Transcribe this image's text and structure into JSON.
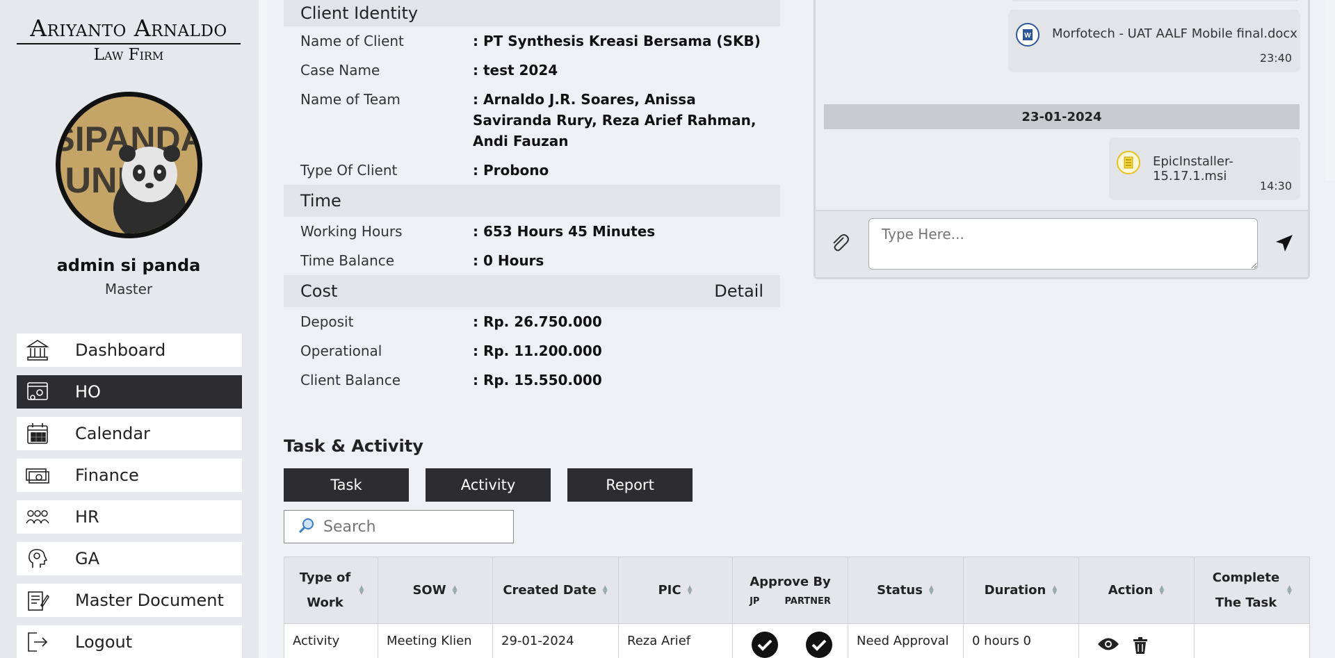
{
  "logo": {
    "line1": "Ariyanto Arnaldo",
    "line2": "Law Firm"
  },
  "avatar": {
    "text": "SIPANDA UNIK"
  },
  "user": {
    "name": "admin si panda",
    "role": "Master"
  },
  "nav": [
    {
      "label": "Dashboard",
      "icon": "bank-icon",
      "active": false
    },
    {
      "label": "HO",
      "icon": "settings-window-icon",
      "active": true
    },
    {
      "label": "Calendar",
      "icon": "calendar-icon",
      "active": false
    },
    {
      "label": "Finance",
      "icon": "money-icon",
      "active": false
    },
    {
      "label": "HR",
      "icon": "people-icon",
      "active": false
    },
    {
      "label": "GA",
      "icon": "head-gear-icon",
      "active": false
    },
    {
      "label": "Master Document",
      "icon": "document-edit-icon",
      "active": false
    },
    {
      "label": "Logout",
      "icon": "logout-icon",
      "active": false
    }
  ],
  "client": {
    "section": "Client Identity",
    "rows": [
      {
        "k": "Name of Client",
        "v": ": PT Synthesis Kreasi Bersama (SKB)"
      },
      {
        "k": "Case Name",
        "v": ": test 2024"
      },
      {
        "k": "Name of Team",
        "v": ": Arnaldo J.R. Soares, Anissa Saviranda Rury, Reza Arief Rahman, Andi Fauzan"
      },
      {
        "k": "Type Of Client",
        "v": ": Probono"
      }
    ]
  },
  "time": {
    "section": "Time",
    "rows": [
      {
        "k": "Working Hours",
        "v": ": 653 Hours 45 Minutes"
      },
      {
        "k": "Time Balance",
        "v": ": 0 Hours"
      }
    ]
  },
  "cost": {
    "section": "Cost",
    "detail": "Detail",
    "rows": [
      {
        "k": "Deposit",
        "v": ": Rp. 26.750.000"
      },
      {
        "k": "Operational",
        "v": ": Rp. 11.200.000"
      },
      {
        "k": "Client Balance",
        "v": ": Rp. 15.550.000"
      }
    ]
  },
  "chat": {
    "msg1": {
      "file": "Morfotech - UAT AALF Mobile final.docx",
      "time": "23:40"
    },
    "date": "23-01-2024",
    "msg2": {
      "file": "EpicInstaller-15.17.1.msi",
      "time": "14:30"
    },
    "placeholder": "Type Here..."
  },
  "tasks": {
    "title": "Task & Activity",
    "tabs": [
      "Task",
      "Activity",
      "Report"
    ],
    "search_placeholder": "Search",
    "columns": {
      "type": "Type of Work",
      "sow": "SOW",
      "created": "Created Date",
      "pic": "PIC",
      "approve": "Approve By",
      "approve_jp": "JP",
      "approve_partner": "PARTNER",
      "status": "Status",
      "duration": "Duration",
      "action": "Action",
      "complete": "Complete The Task"
    },
    "rows": [
      {
        "type": "Activity",
        "sow": "Meeting Klien",
        "created": "29-01-2024",
        "pic": "Reza Arief",
        "status": "Need Approval",
        "duration": "0 hours 0"
      }
    ]
  }
}
